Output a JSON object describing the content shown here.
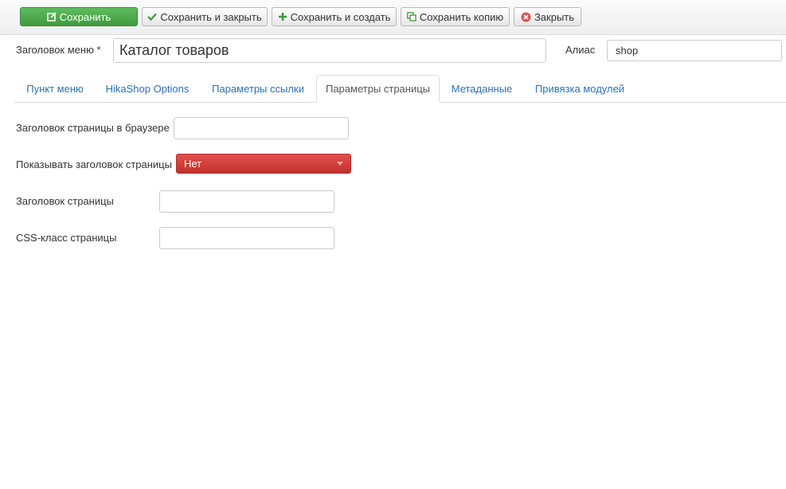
{
  "toolbar": {
    "save_label": "Сохранить",
    "save_close_label": "Сохранить и закрыть",
    "save_new_label": "Сохранить и создать",
    "save_copy_label": "Сохранить копию",
    "close_label": "Закрыть"
  },
  "header": {
    "menu_title_label": "Заголовок меню *",
    "menu_title_value": "Каталог товаров",
    "alias_label": "Алиас",
    "alias_value": "shop"
  },
  "tabs": [
    {
      "label": "Пункт меню"
    },
    {
      "label": "HikaShop Options"
    },
    {
      "label": "Параметры ссылки"
    },
    {
      "label": "Параметры страницы",
      "active": true
    },
    {
      "label": "Метаданные"
    },
    {
      "label": "Привязка модулей"
    }
  ],
  "form": {
    "browser_title_label": "Заголовок страницы в браузере",
    "browser_title_value": "",
    "show_heading_label": "Показывать заголовок страницы",
    "show_heading_value": "Нет",
    "page_heading_label": "Заголовок страницы",
    "page_heading_value": "",
    "css_class_label": "CSS-класс страницы",
    "css_class_value": ""
  },
  "colors": {
    "primary_green": "#4cae4c",
    "danger_red": "#d9534f",
    "link_blue": "#2f6fb5"
  },
  "icons": {
    "save": "edit-icon",
    "save_close": "check-icon",
    "save_new": "plus-icon",
    "save_copy": "copy-icon",
    "close": "close-circle-icon"
  }
}
